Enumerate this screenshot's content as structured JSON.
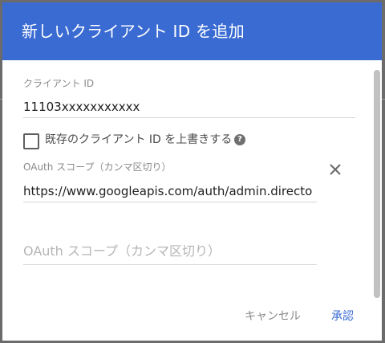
{
  "dialog": {
    "title": "新しいクライアント ID を追加"
  },
  "client_id": {
    "label": "クライアント ID",
    "value": "11103xxxxxxxxxxx"
  },
  "overwrite": {
    "label": "既存のクライアント ID を上書きする",
    "checked": false,
    "help_glyph": "?"
  },
  "scope_1": {
    "label": "OAuth スコープ（カンマ区切り）",
    "value": "https://www.googleapis.com/auth/admin.directo"
  },
  "scope_2": {
    "placeholder": "OAuth スコープ（カンマ区切り）"
  },
  "actions": {
    "cancel": "キャンセル",
    "approve": "承認"
  },
  "colors": {
    "header": "#3a6bd3",
    "accent": "#3a6bd3"
  }
}
